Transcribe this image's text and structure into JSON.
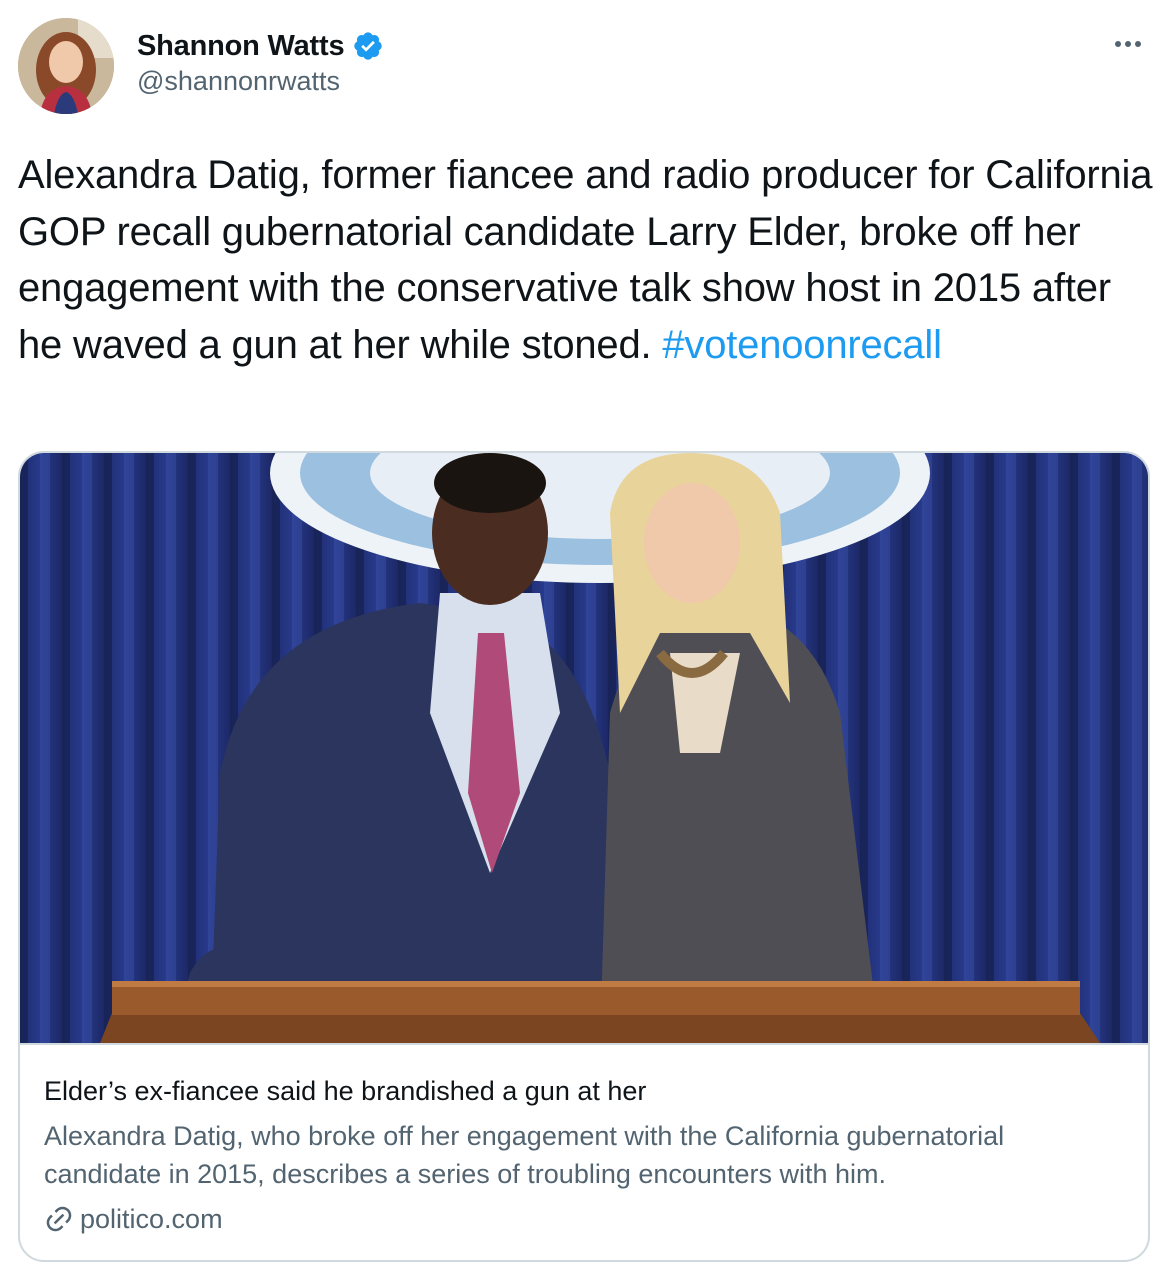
{
  "author": {
    "display_name": "Shannon Watts",
    "handle": "@shannonrwatts",
    "verified": true,
    "avatar_icon": "profile-photo"
  },
  "tweet": {
    "text": "Alexandra Datig, former fiancee and radio producer for California GOP recall gubernatorial candidate Larry Elder, broke off her engagement with the conservative talk show host in 2015 after he waved a gun at her while stoned.",
    "hashtag": "#votenoonrecall"
  },
  "card": {
    "title": "Elder’s ex-fiancee said he brandished a gun at her",
    "description": "Alexandra Datig, who broke off her engagement with the California gubernatorial candidate in 2015, describes a series of troubling encounters with him.",
    "domain": "politico.com",
    "domain_icon": "link-icon"
  },
  "colors": {
    "text_primary": "#0f1419",
    "text_secondary": "#536471",
    "link": "#1d9bf0",
    "verified_badge": "#1d9bf0",
    "border": "#cfd9de"
  }
}
